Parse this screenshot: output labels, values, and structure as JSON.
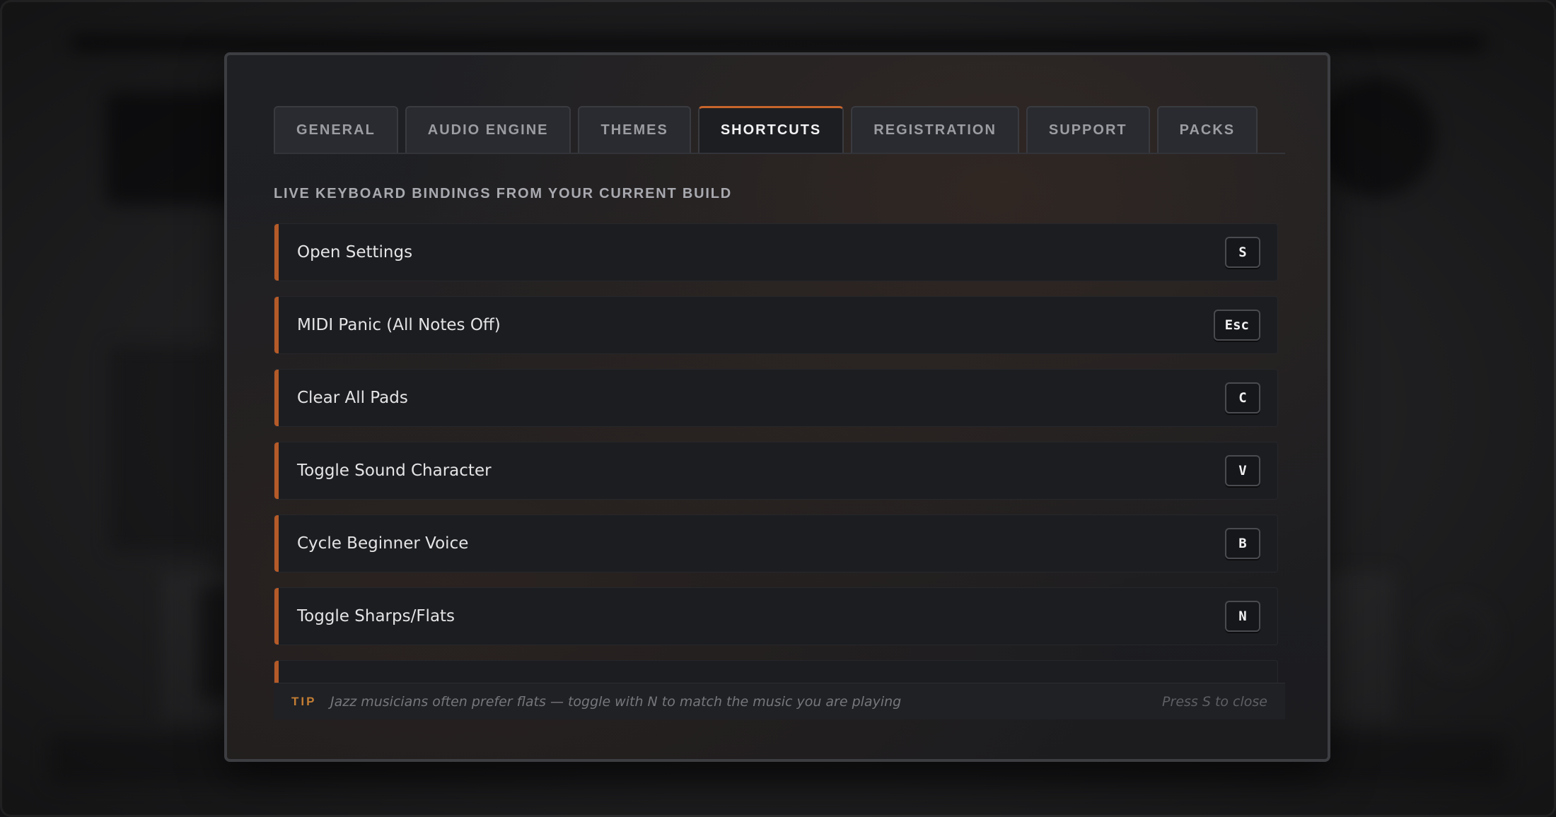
{
  "tabs": [
    {
      "label": "GENERAL",
      "active": false
    },
    {
      "label": "AUDIO ENGINE",
      "active": false
    },
    {
      "label": "THEMES",
      "active": false
    },
    {
      "label": "SHORTCUTS",
      "active": true
    },
    {
      "label": "REGISTRATION",
      "active": false
    },
    {
      "label": "SUPPORT",
      "active": false
    },
    {
      "label": "PACKS",
      "active": false
    }
  ],
  "section_title": "LIVE KEYBOARD BINDINGS FROM YOUR CURRENT BUILD",
  "shortcuts": [
    {
      "label": "Open Settings",
      "key": "S"
    },
    {
      "label": "MIDI Panic (All Notes Off)",
      "key": "Esc"
    },
    {
      "label": "Clear All Pads",
      "key": "C"
    },
    {
      "label": "Toggle Sound Character",
      "key": "V"
    },
    {
      "label": "Cycle Beginner Voice",
      "key": "B"
    },
    {
      "label": "Toggle Sharps/Flats",
      "key": "N"
    }
  ],
  "tip": {
    "tag": "TIP",
    "text": "Jazz musicians often prefer flats — toggle with N to match the music you are playing",
    "close_hint": "Press S to close"
  },
  "colors": {
    "accent": "#c8652c",
    "row_accent": "#b45a28",
    "tip_tag": "#c47e33"
  }
}
